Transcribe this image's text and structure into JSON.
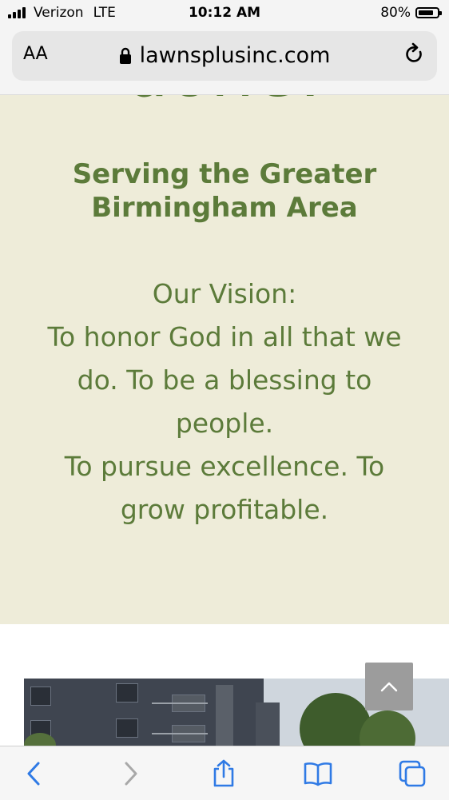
{
  "status_bar": {
    "carrier": "Verizon",
    "network": "LTE",
    "time": "10:12 AM",
    "battery_percent": "80%",
    "battery_level": 0.8
  },
  "browser": {
    "text_size_label": "AA",
    "url": "lawnsplusinc.com",
    "icons": [
      "lock-icon",
      "reload-icon"
    ]
  },
  "hero": {
    "headline_fragment": "done!",
    "tagline_line1": "Serving the Greater",
    "tagline_line2": "Birmingham Area",
    "vision_heading": "Our Vision:",
    "vision_line1": "To honor God in all that we",
    "vision_line2": "do. To be a blessing to",
    "vision_line3": "people.",
    "vision_line4": "To pursue excellence. To",
    "vision_line5": "grow profitable."
  },
  "colors": {
    "hero_background": "#eeecd9",
    "brand_green": "#5c7b3a",
    "back_to_top_bg": "#9c9c9c",
    "toolbar_blue": "#2f7ae5"
  },
  "toolbar": {
    "icons": [
      "back-chevron-icon",
      "forward-chevron-icon",
      "share-icon",
      "bookmarks-icon",
      "tabs-icon"
    ]
  }
}
